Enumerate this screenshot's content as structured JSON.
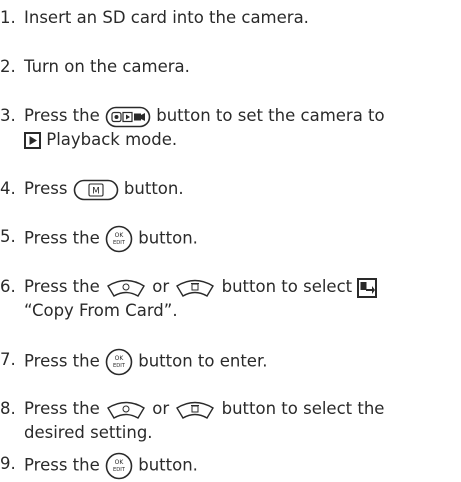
{
  "steps": [
    {
      "num": "1.",
      "text": "Insert an SD card into the camera."
    },
    {
      "num": "2.",
      "text": "Turn on the camera."
    },
    {
      "num": "3.",
      "pre": "Press the ",
      "post": " button to set the camera to",
      "line2": " Playback mode.",
      "icons": [
        "mode-button-icon",
        "playback-icon"
      ]
    },
    {
      "num": "4.",
      "pre": "Press ",
      "post": " button.",
      "icons": [
        "menu-button-icon"
      ]
    },
    {
      "num": "5.",
      "pre": "Press the ",
      "post": " button.",
      "icons": [
        "ok-edit-button-icon"
      ],
      "btn_top": "OK",
      "btn_bot": "EDIT"
    },
    {
      "num": "6.",
      "pre": "Press the ",
      "mid": " or ",
      "post": " button to select ",
      "line2": "“Copy From Card”.",
      "icons": [
        "up-button-icon",
        "down-delete-button-icon",
        "copy-from-card-icon"
      ]
    },
    {
      "num": "7.",
      "pre": "Press the ",
      "post": " button to enter.",
      "icons": [
        "ok-edit-button-icon"
      ],
      "btn_top": "OK",
      "btn_bot": "EDIT"
    },
    {
      "num": "8.",
      "pre": "Press the ",
      "mid": " or ",
      "post": " button to select the",
      "line2": "desired setting.",
      "icons": [
        "up-button-icon",
        "down-delete-button-icon"
      ]
    },
    {
      "num": "9.",
      "pre": "Press the ",
      "post": " button.",
      "icons": [
        "ok-edit-button-icon"
      ],
      "btn_top": "OK",
      "btn_bot": "EDIT"
    }
  ],
  "menu_button_letter": "M"
}
